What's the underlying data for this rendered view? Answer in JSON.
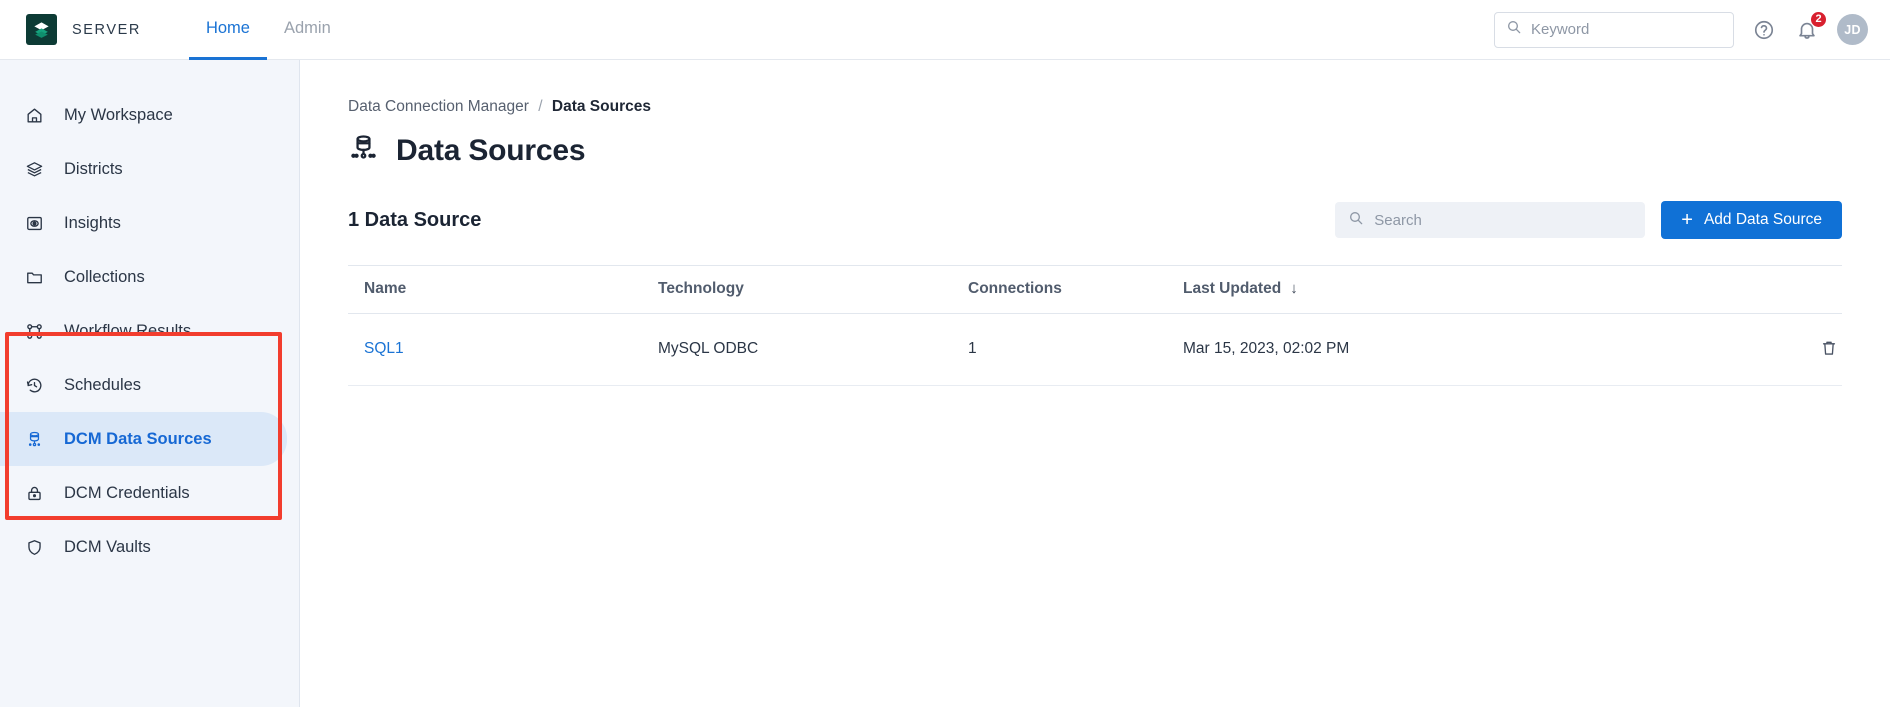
{
  "header": {
    "brand_name": "SERVER",
    "logo_icon": "layers-logo-icon",
    "tabs": [
      {
        "label": "Home",
        "active": true
      },
      {
        "label": "Admin",
        "active": false
      }
    ],
    "search": {
      "placeholder": "Keyword",
      "value": "",
      "icon": "search-icon"
    },
    "help_icon": "help-circle-icon",
    "notifications": {
      "icon": "bell-icon",
      "badge_count": "2"
    },
    "avatar_initials": "JD"
  },
  "sidebar": {
    "items": [
      {
        "label": "My Workspace",
        "icon": "home-icon",
        "active": false
      },
      {
        "label": "Districts",
        "icon": "layers-icon",
        "active": false
      },
      {
        "label": "Insights",
        "icon": "insights-eye-icon",
        "active": false
      },
      {
        "label": "Collections",
        "icon": "folder-icon",
        "active": false
      },
      {
        "label": "Workflow Results",
        "icon": "workflow-icon",
        "active": false
      },
      {
        "label": "Schedules",
        "icon": "history-clock-icon",
        "active": false
      },
      {
        "label": "DCM Data Sources",
        "icon": "database-node-icon",
        "active": true
      },
      {
        "label": "DCM Credentials",
        "icon": "lock-icon",
        "active": false
      },
      {
        "label": "DCM Vaults",
        "icon": "shield-icon",
        "active": false
      }
    ],
    "annotation_color": "#f23d2e"
  },
  "main": {
    "breadcrumb": {
      "parent": "Data Connection Manager",
      "separator": "/",
      "current": "Data Sources"
    },
    "page_title": "Data Sources",
    "page_title_icon": "data-source-database-icon",
    "count_label": "1 Data Source",
    "search": {
      "placeholder": "Search",
      "value": "",
      "icon": "search-icon"
    },
    "add_button": {
      "label": "Add Data Source",
      "icon": "plus-icon"
    },
    "table": {
      "columns": [
        {
          "key": "name",
          "label": "Name"
        },
        {
          "key": "technology",
          "label": "Technology"
        },
        {
          "key": "connections",
          "label": "Connections"
        },
        {
          "key": "last_updated",
          "label": "Last Updated",
          "sort": "desc",
          "sort_glyph": "↓"
        },
        {
          "key": "actions",
          "label": ""
        }
      ],
      "rows": [
        {
          "name": "SQL1",
          "technology": "MySQL ODBC",
          "connections": "1",
          "last_updated": "Mar 15, 2023, 02:02 PM",
          "delete_icon": "trash-icon"
        }
      ]
    }
  },
  "colors": {
    "accent_blue": "#1a73d4",
    "button_blue": "#1071d6",
    "badge_red": "#d8202f",
    "annotation_red": "#f23d2e",
    "sidebar_bg": "#f3f6fb",
    "active_item_bg": "#dbe8f8",
    "logo_bg": "#0d3b35"
  }
}
